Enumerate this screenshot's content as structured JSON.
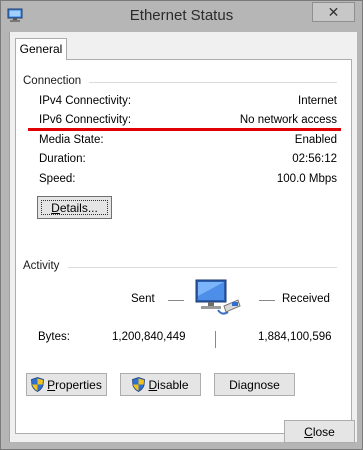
{
  "window": {
    "title": "Ethernet Status"
  },
  "tab": {
    "label": "General"
  },
  "connection": {
    "section_title": "Connection",
    "rows": [
      {
        "label": "IPv4 Connectivity:",
        "value": "Internet"
      },
      {
        "label": "IPv6 Connectivity:",
        "value": "No network access"
      },
      {
        "label": "Media State:",
        "value": "Enabled"
      },
      {
        "label": "Duration:",
        "value": "02:56:12"
      },
      {
        "label": "Speed:",
        "value": "100.0 Mbps"
      }
    ],
    "details_button": {
      "prefix": "",
      "accel": "D",
      "rest": "etails..."
    }
  },
  "activity": {
    "section_title": "Activity",
    "sent_label": "Sent",
    "received_label": "Received",
    "bytes_label": "Bytes:",
    "bytes_sent": "1,200,840,449",
    "bytes_received": "1,884,100,596"
  },
  "buttons": {
    "properties": {
      "accel": "P",
      "rest": "roperties"
    },
    "disable": {
      "accel": "D",
      "rest": "isable"
    },
    "diagnose": {
      "prefix": "Dia",
      "accel": "g",
      "rest": "nose"
    }
  },
  "close_button": {
    "accel": "C",
    "rest": "lose"
  },
  "colors": {
    "highlight_underline": "#e00000",
    "shield_blue": "#2f6fd0",
    "shield_yellow": "#f2c21a"
  },
  "icons": [
    "network-icon",
    "network-computer-icon",
    "shield-icon",
    "close-icon"
  ]
}
